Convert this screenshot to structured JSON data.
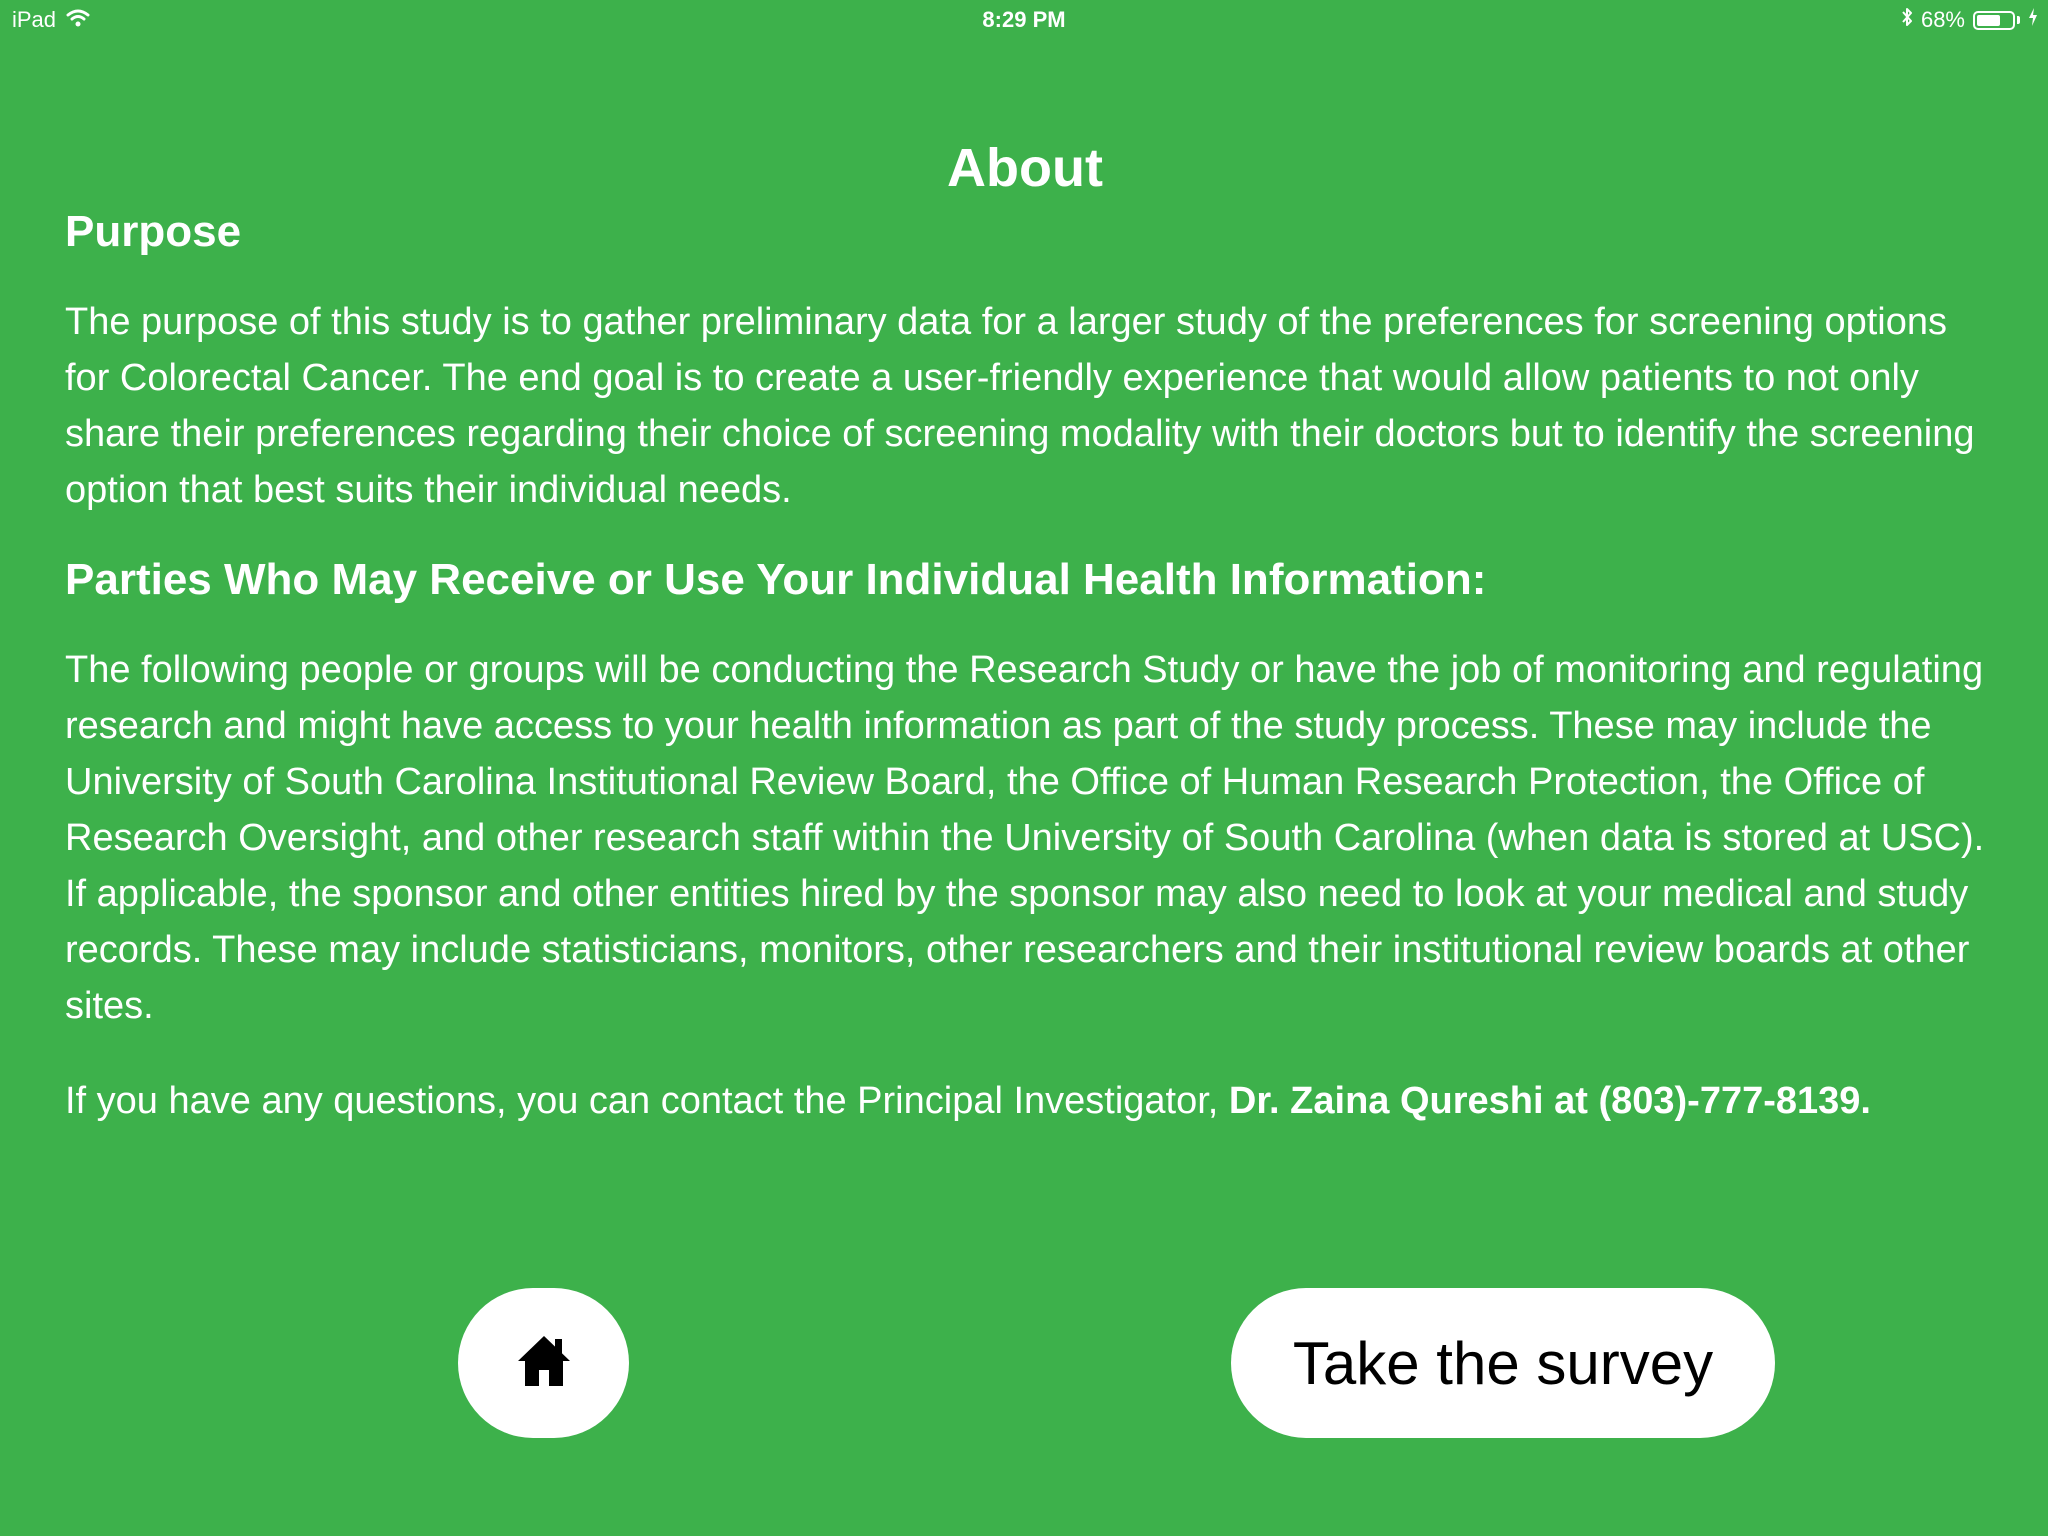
{
  "status_bar": {
    "device": "iPad",
    "time": "8:29 PM",
    "battery_percent": "68%",
    "battery_level": 0.68,
    "icons": [
      "wifi-icon",
      "bluetooth-icon",
      "battery-icon",
      "charging-icon"
    ]
  },
  "page": {
    "title": "About"
  },
  "sections": {
    "purpose": {
      "heading": "Purpose",
      "body": "The purpose of this study is to gather preliminary data for a larger study of the preferences for screening options for Colorectal Cancer. The end goal is to create a user-friendly experience that would allow patients to not only share their preferences regarding their choice of screening modality with their doctors but to identify the screening option that best suits their individual needs."
    },
    "parties": {
      "heading": "Parties Who May Receive or Use Your Individual Health Information:",
      "body": "The following people or groups will be conducting the Research Study or have the job of monitoring and regulating research and might have access to your health information as part of the study process. These may include the University of South Carolina Institutional Review Board, the Office of Human Research Protection, the Office of Research Oversight, and other research staff within the University of South Carolina (when data is stored at USC). If applicable, the sponsor and other entities hired by the sponsor may also need to look at your medical and study records. These may include statisticians, monitors, other researchers and their institutional review boards at other sites."
    },
    "contact": {
      "text": "If you have any questions, you can contact the Principal Investigator, ",
      "bold": "Dr. Zaina Qureshi at (803)-777-8139."
    }
  },
  "buttons": {
    "home_icon": "home-icon",
    "survey_label": "Take the survey"
  },
  "colors": {
    "background": "#3db14b",
    "text": "#ffffff",
    "button_background": "#ffffff",
    "button_text": "#000000"
  }
}
